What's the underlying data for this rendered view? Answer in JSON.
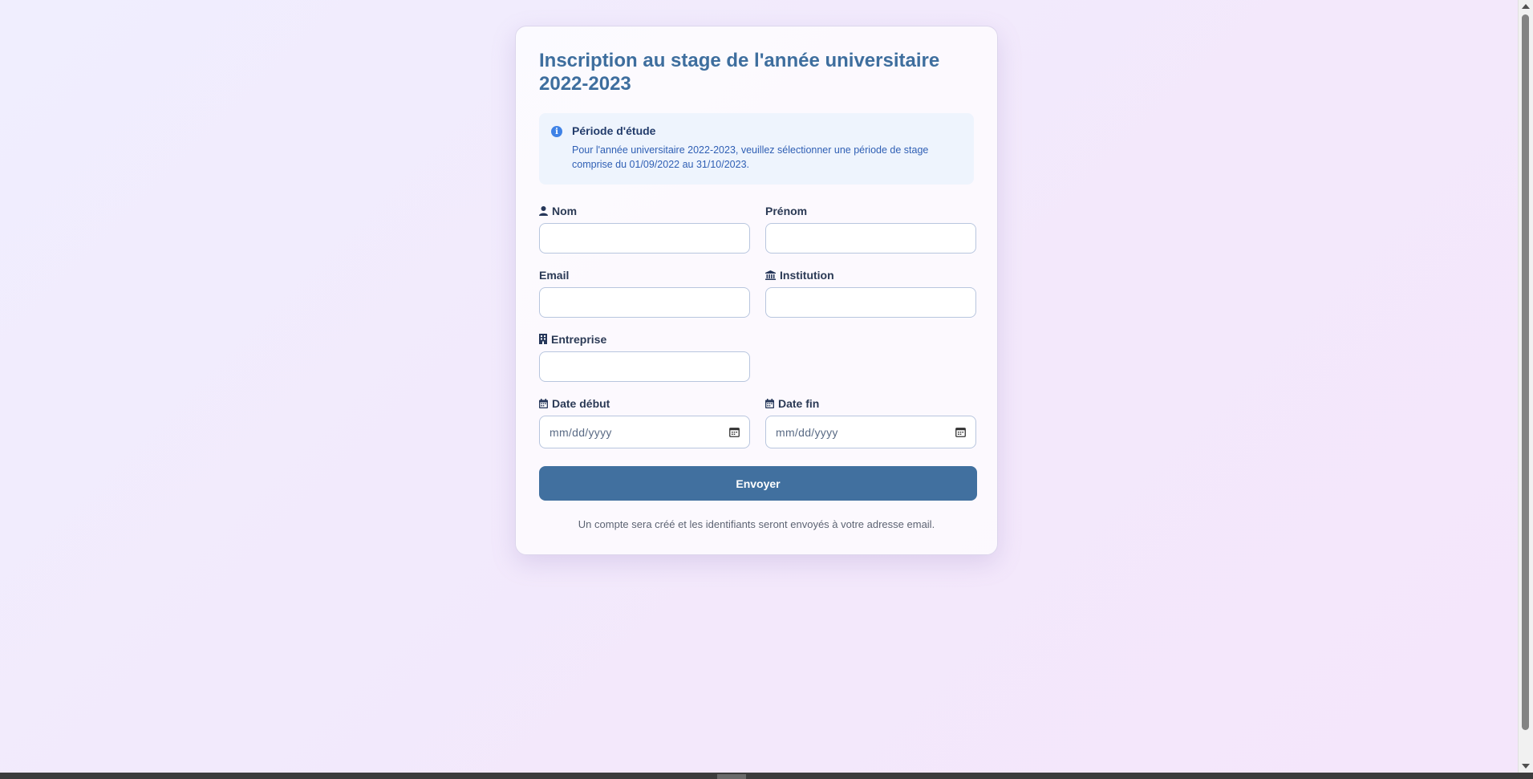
{
  "form": {
    "title": "Inscription au stage de l'année universitaire 2022-2023",
    "info": {
      "icon": "info-icon",
      "title": "Période d'étude",
      "text": "Pour l'année universitaire 2022-2023, veuillez sélectionner une période de stage comprise du 01/09/2022 au 31/10/2023."
    },
    "fields": {
      "nom": {
        "label": "Nom",
        "icon": "user-icon",
        "value": ""
      },
      "prenom": {
        "label": "Prénom",
        "value": ""
      },
      "email": {
        "label": "Email",
        "value": ""
      },
      "institution": {
        "label": "Institution",
        "icon": "institution-icon",
        "value": ""
      },
      "entreprise": {
        "label": "Entreprise",
        "icon": "building-icon",
        "value": ""
      },
      "date_debut": {
        "label": "Date début",
        "icon": "calendar-icon",
        "placeholder": "mm/dd/yyyy"
      },
      "date_fin": {
        "label": "Date fin",
        "icon": "calendar-icon",
        "placeholder": "mm/dd/yyyy"
      }
    },
    "submit_label": "Envoyer",
    "note": "Un compte sera créé et les identifiants seront envoyés à votre adresse email."
  },
  "colors": {
    "title": "#3e6e9e",
    "button": "#41709f",
    "info_bg": "#eef4fd",
    "info_icon": "#3f82e6"
  }
}
